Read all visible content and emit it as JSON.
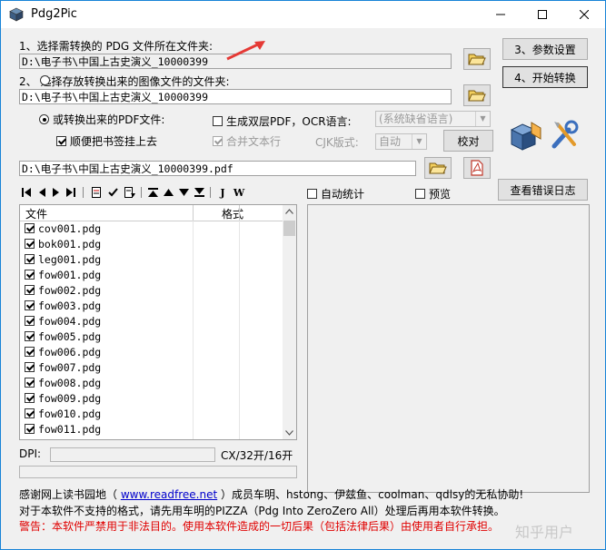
{
  "window": {
    "title": "Pdg2Pic",
    "controls": {
      "minimize": "—",
      "maximize": "☐",
      "close": "✕"
    }
  },
  "step1": {
    "label": "1、选择需转换的 PDG 文件所在文件夹:",
    "path": "D:\\电子书\\中国上古史演义_10000399"
  },
  "step2": {
    "label": "2、 选择存放转换出来的图像文件的文件夹:",
    "path": "D:\\电子书\\中国上古史演义_10000399"
  },
  "buttons": {
    "params": "3、参数设置",
    "start": "4、开始转换",
    "verify": "校对",
    "error_log": "查看错误日志"
  },
  "pdf_options": {
    "convert_pdf": "或转换出来的PDF文件:",
    "bookmark": "顺便把书签挂上去",
    "double_layer": "生成双层PDF，OCR语言:",
    "ocr_language": "(系统缺省语言)",
    "merge_text": "合并文本行",
    "cjk_label": "CJK版式:",
    "cjk_value": "自动",
    "pdf_path": "D:\\电子书\\中国上古史演义_10000399.pdf"
  },
  "toolbar": {
    "tool_j": "J",
    "tool_w": "W"
  },
  "checks": {
    "auto_stat": "自动统计",
    "preview": "预览"
  },
  "file_list": {
    "columns": [
      "文件",
      "格式"
    ],
    "rows": [
      "cov001.pdg",
      "bok001.pdg",
      "leg001.pdg",
      "fow001.pdg",
      "fow002.pdg",
      "fow003.pdg",
      "fow004.pdg",
      "fow005.pdg",
      "fow006.pdg",
      "fow007.pdg",
      "fow008.pdg",
      "fow009.pdg",
      "fow010.pdg",
      "fow011.pdg"
    ]
  },
  "dpi": {
    "label": "DPI:",
    "value": "CX/32开/16开"
  },
  "footer": {
    "line1_a": "感谢网上读书园地（ ",
    "line1_link": "www.readfree.net",
    "line1_b": " ）成员车明、hstong、伊兹鱼、coolman、qdlsy的无私协助!",
    "line2": "对于本软件不支持的格式，请先用车明的PIZZA（Pdg Into ZeroZero All）处理后再用本软件转换。",
    "warning": "警告：本软件严禁用于非法目的。使用本软件造成的一切后果（包括法律后果）由使用者自行承担。"
  },
  "watermark": "知乎用户",
  "colors": {
    "accent": "#1883d7",
    "warning": "#e00000",
    "link": "#0000cc",
    "arrow": "#e53935"
  }
}
